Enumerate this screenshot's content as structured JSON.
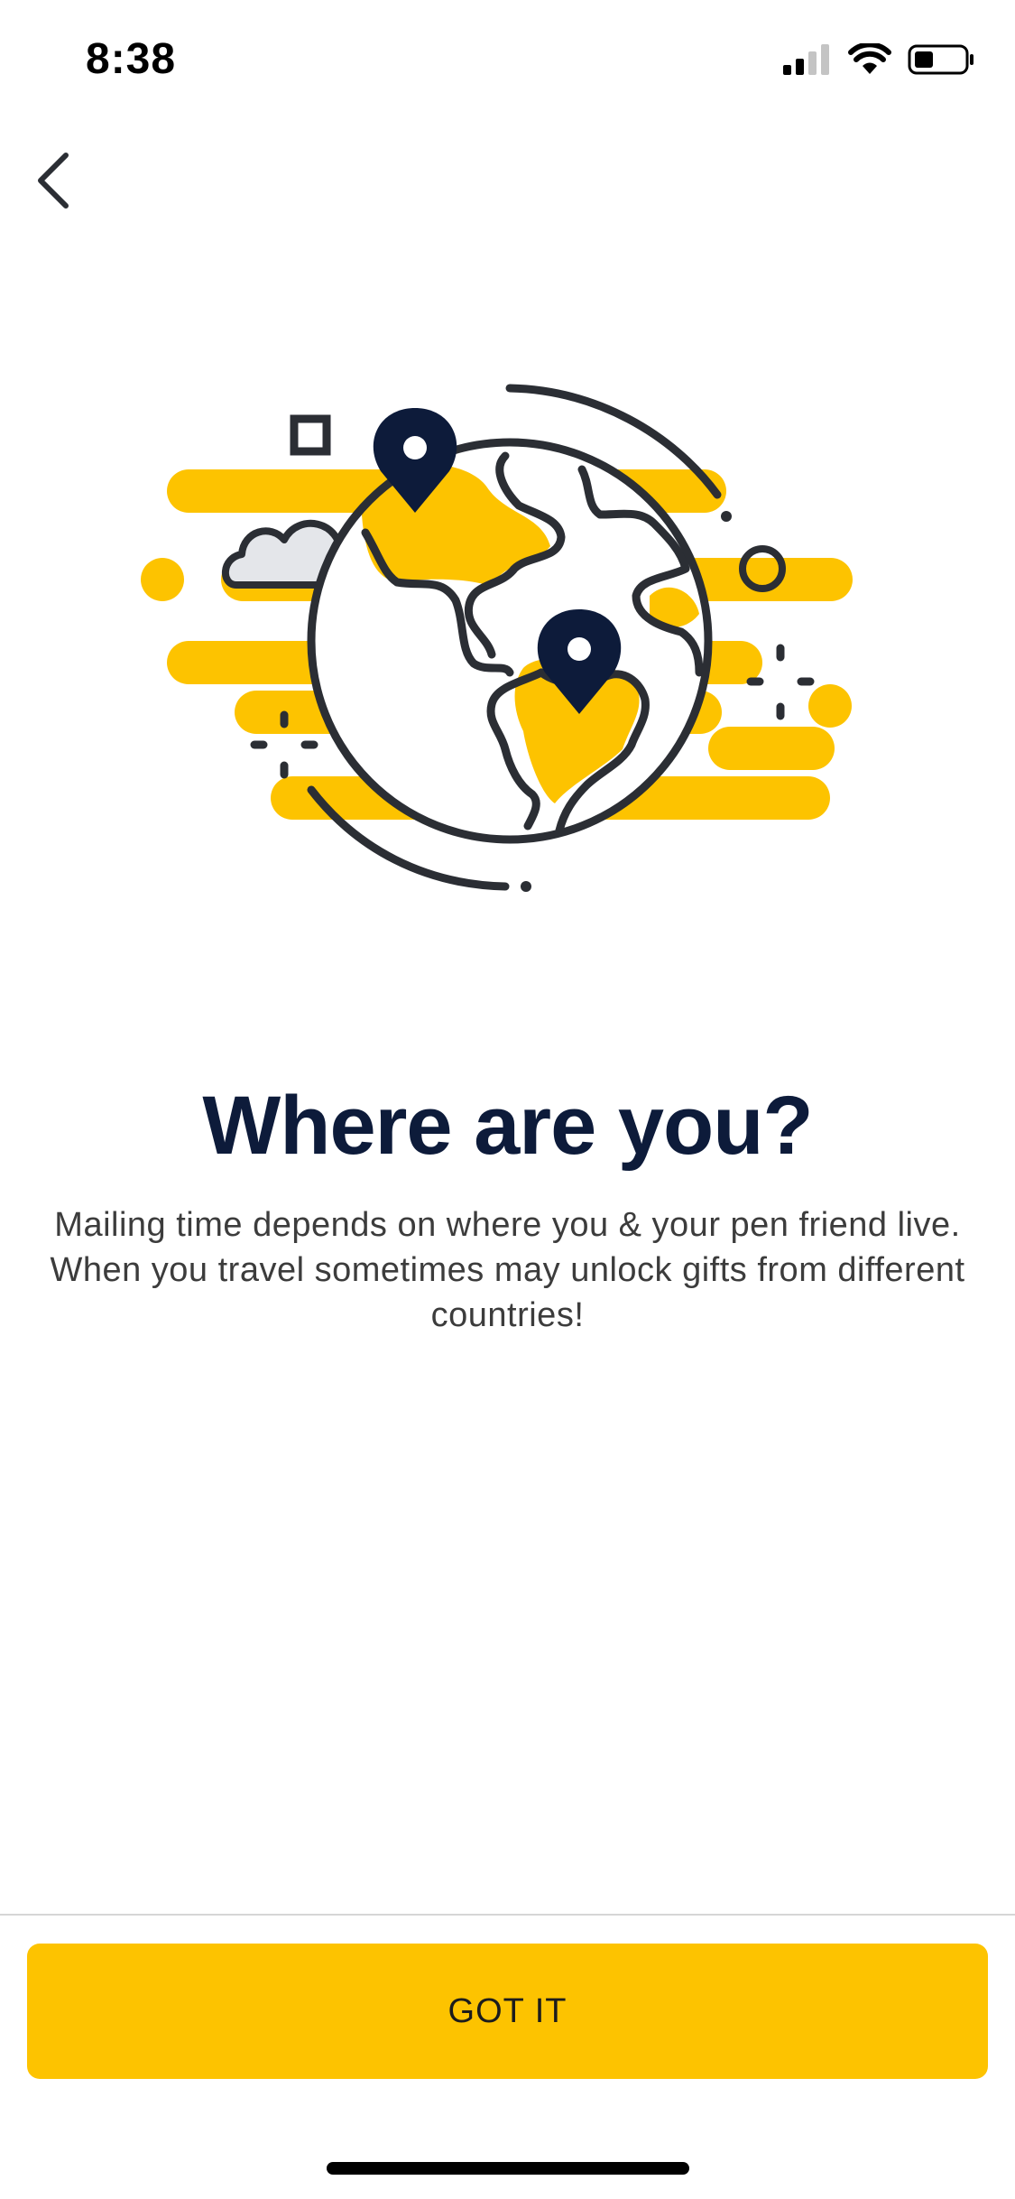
{
  "status_bar": {
    "time": "8:38",
    "icons": [
      "cellular-signal-icon",
      "wifi-icon",
      "battery-icon"
    ]
  },
  "nav": {
    "back_icon": "chevron-left-icon"
  },
  "illustration": {
    "subject": "globe-with-map-pins-icon",
    "colors": {
      "accent": "#fdc300",
      "outline": "#2b2e34",
      "pin": "#0d1b3a",
      "cloud": "#e4e6ea"
    }
  },
  "content": {
    "title": "Where are you?",
    "description": "Mailing time depends on where you & your pen friend live. When you travel sometimes may unlock gifts from different countries!"
  },
  "footer": {
    "button_label": "GOT IT"
  },
  "colors": {
    "brand_yellow": "#fdc300",
    "title_navy": "#0d1b3a",
    "body_text": "#3c3c3c"
  }
}
